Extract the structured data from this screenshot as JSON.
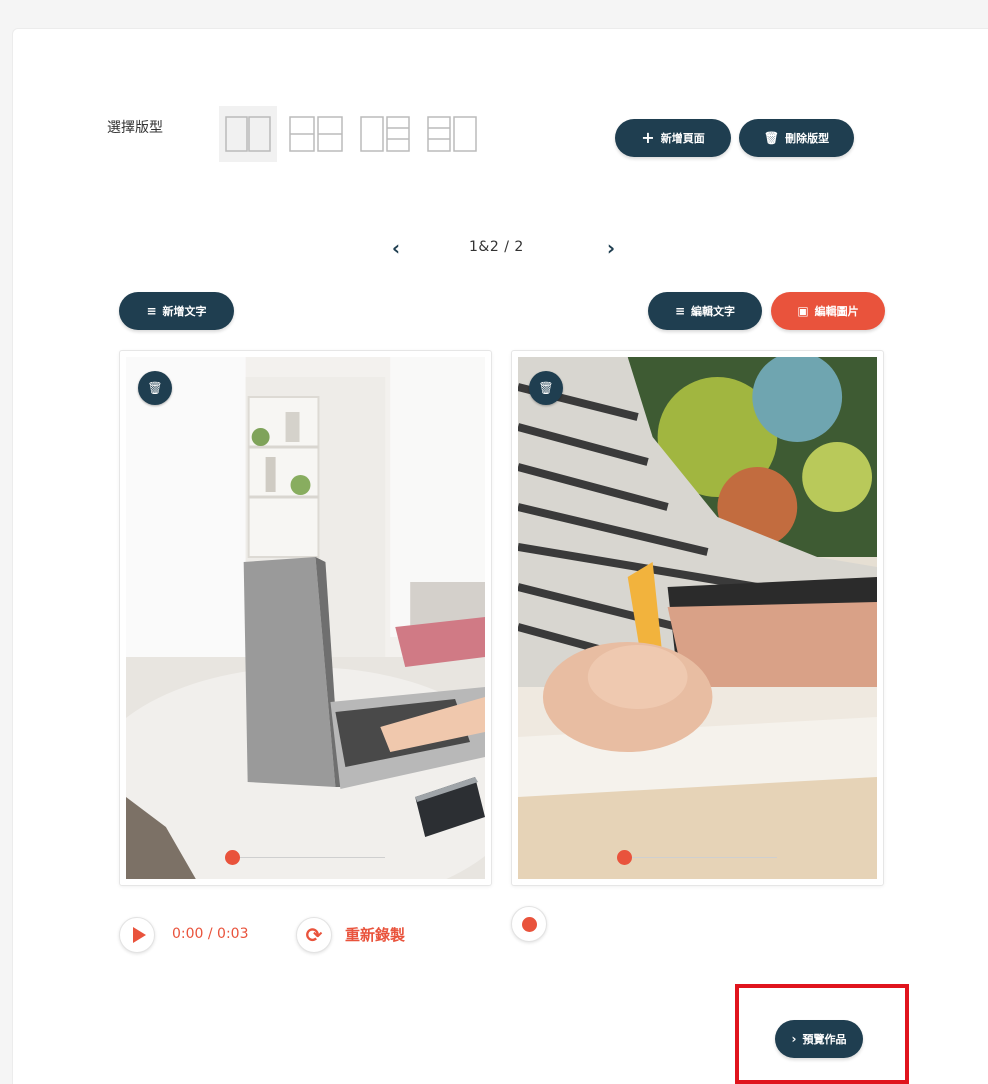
{
  "layout_picker": {
    "label": "選擇版型",
    "options": [
      "two-columns",
      "left-split-right-split",
      "single-left-triple-right",
      "triple-left-single-right"
    ]
  },
  "toolbar": {
    "add_page_label": "新增頁面",
    "delete_layout_label": "刪除版型"
  },
  "pager": {
    "prev_icon": "chevron-left-icon",
    "next_icon": "chevron-right-icon",
    "current": "1&2",
    "separator": "/",
    "total": "2"
  },
  "editor": {
    "add_text_label": "新增文字",
    "edit_text_label": "編輯文字",
    "edit_image_label": "編輯圖片"
  },
  "pages": [
    {
      "audio_time": "0:00 / 0:03",
      "rerecord_label": "重新錄製",
      "audio_progress": 0
    },
    {
      "audio_progress": 0
    }
  ],
  "footer": {
    "preview_label": "預覽作品"
  },
  "colors": {
    "navy": "#1f3e50",
    "accent": "#e9533c",
    "highlight": "#e0141d"
  }
}
